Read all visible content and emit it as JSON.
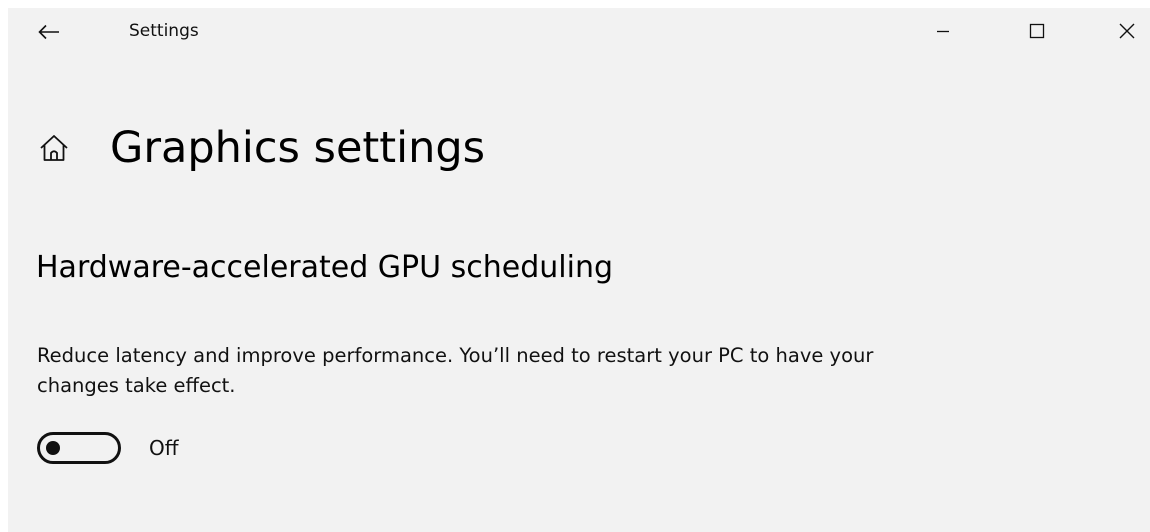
{
  "titlebar": {
    "back_icon": "back-arrow-icon",
    "app_title": "Settings",
    "minimize_icon": "minimize-icon",
    "maximize_icon": "maximize-icon",
    "close_icon": "close-icon"
  },
  "header": {
    "home_icon": "home-icon",
    "title": "Graphics settings"
  },
  "gpu_scheduling": {
    "heading": "Hardware-accelerated GPU scheduling",
    "description": "Reduce latency and improve performance. You’ll need to restart your PC to have your changes take effect.",
    "toggle_state": false,
    "toggle_label": "Off"
  }
}
